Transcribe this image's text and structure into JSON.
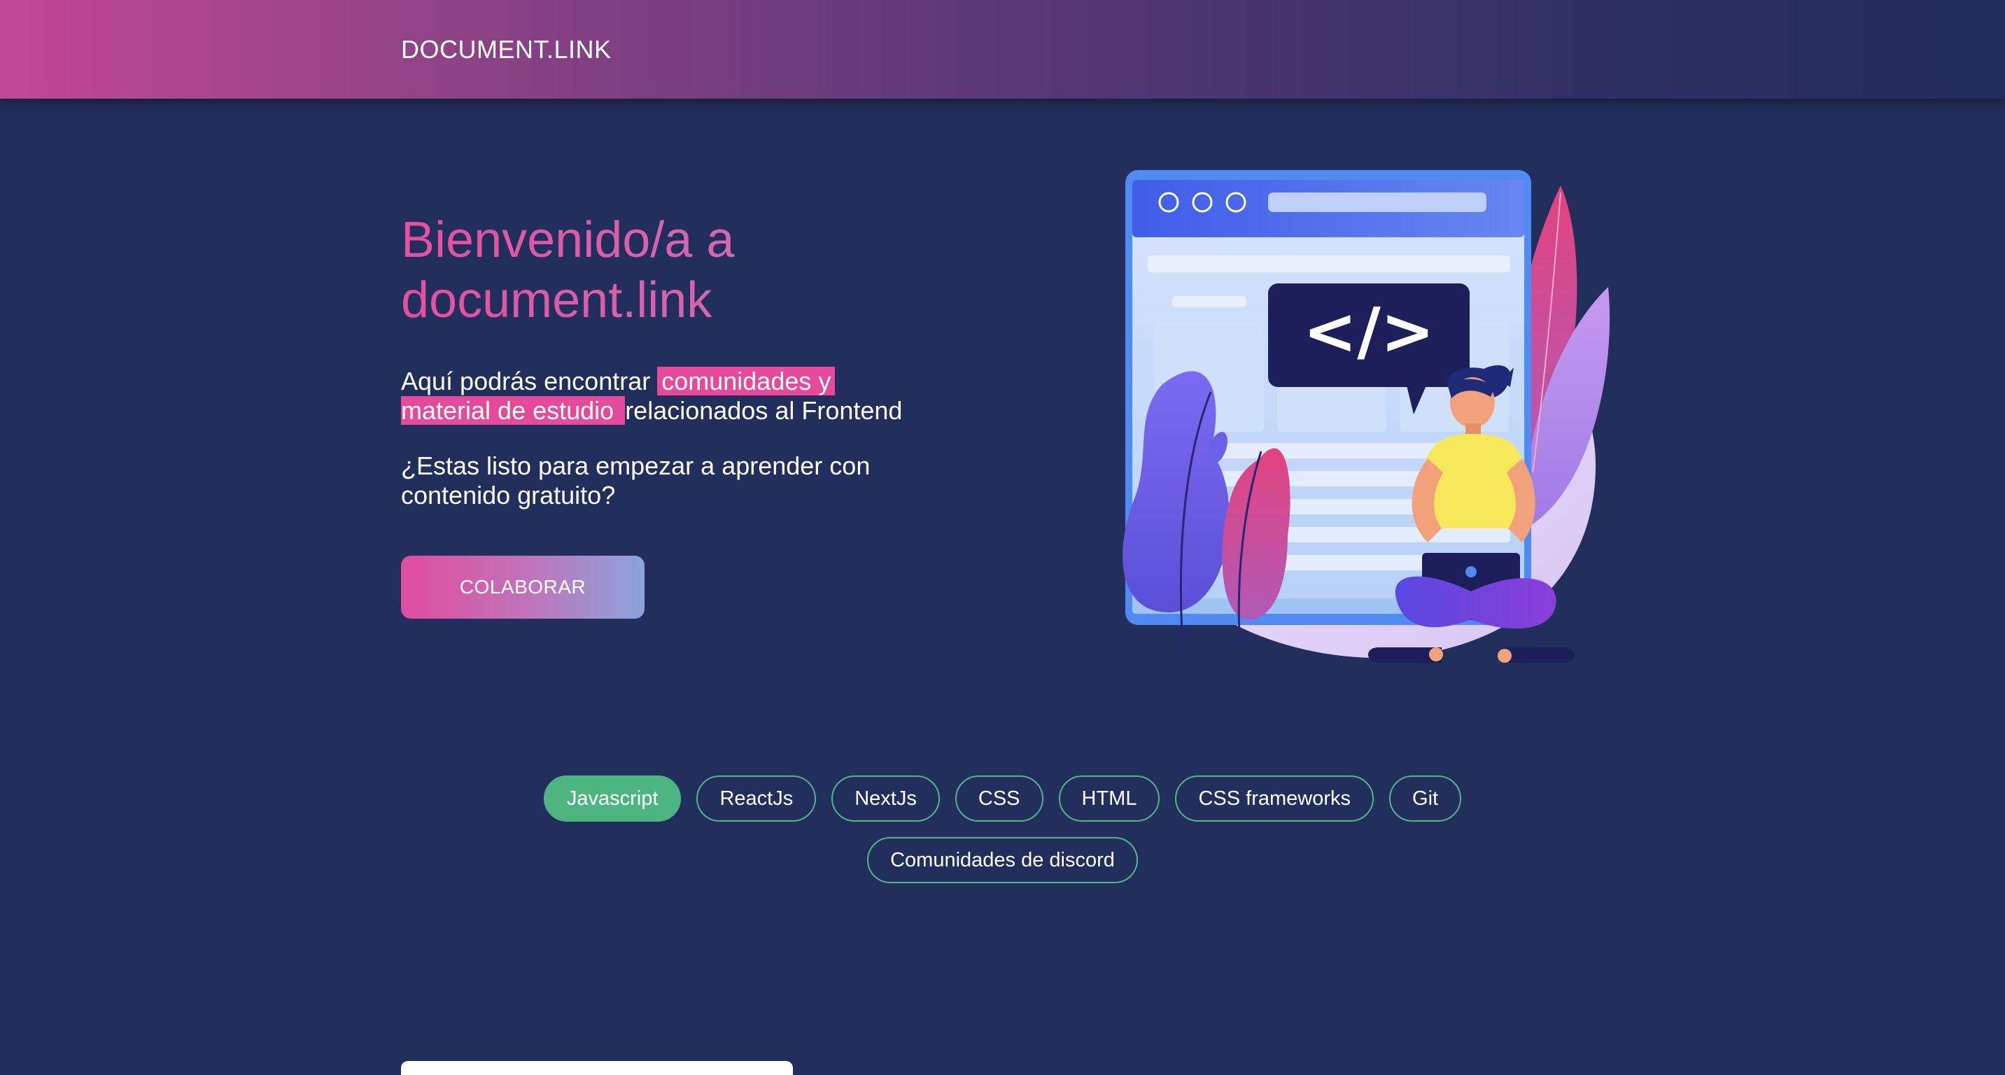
{
  "header": {
    "brand": "DOCUMENT.LINK"
  },
  "hero": {
    "title_line1": "Bienvenido/a a",
    "title_line2": "document.link",
    "intro_before": "Aquí podrás encontrar ",
    "intro_highlight1": "comunidades y",
    "intro_highlight2": "material de estudio ",
    "intro_after": " relacionados al Frontend",
    "question": "¿Estas listo para empezar a aprender con contenido gratuito?",
    "cta_label": "COLABORAR"
  },
  "illustration": {
    "code_label": "</>"
  },
  "tags": [
    {
      "label": "Javascript",
      "active": true
    },
    {
      "label": "ReactJs",
      "active": false
    },
    {
      "label": "NextJs",
      "active": false
    },
    {
      "label": "CSS",
      "active": false
    },
    {
      "label": "HTML",
      "active": false
    },
    {
      "label": "CSS frameworks",
      "active": false
    },
    {
      "label": "Git",
      "active": false
    },
    {
      "label": "Comunidades de discord",
      "active": false
    }
  ],
  "colors": {
    "background": "#222e5c",
    "accent_pink": "#e54a9a",
    "tag_green": "#4cb582"
  }
}
